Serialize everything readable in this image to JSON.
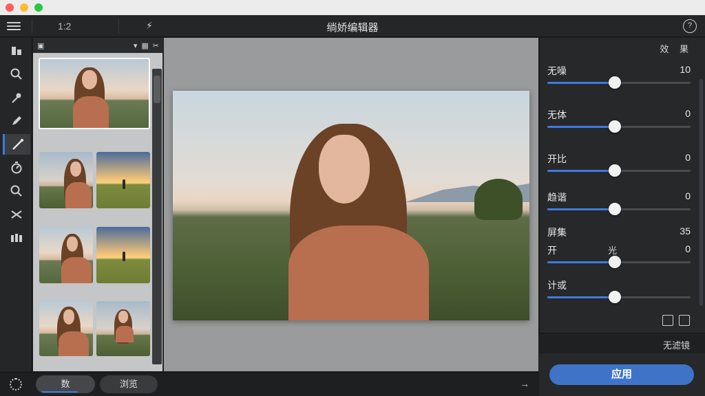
{
  "toolbar": {
    "ratio": "1:2",
    "title": "绱娇编辑器",
    "flash_icon": "lightning-icon",
    "right_icon": "help-circle-icon"
  },
  "rail": {
    "tools": [
      "layers-icon",
      "search-icon",
      "eyedropper-icon",
      "pencil-icon",
      "brush-icon",
      "timer-icon",
      "zoom-icon",
      "shuffle-icon",
      "panels-icon"
    ],
    "active_index": 4
  },
  "strip": {
    "head_icons": [
      "image-icon",
      "chevron-down-icon",
      "grid-icon",
      "crop-icon"
    ]
  },
  "panel": {
    "head": "效 果",
    "adjustments": [
      {
        "label": "无噪",
        "value": "10",
        "pos": 0.47
      },
      {
        "label": "无体",
        "value": "0",
        "pos": 0.47
      },
      {
        "label": "开比",
        "value": "0",
        "pos": 0.47
      },
      {
        "label": "趋谐",
        "value": "0",
        "pos": 0.47
      },
      {
        "label": "屏集",
        "value": "35",
        "pos": null
      },
      {
        "label": "开",
        "mid": "光",
        "value": "0",
        "pos": 0.47
      },
      {
        "label": "计或",
        "value": "",
        "pos": 0.47
      }
    ],
    "preset_label": "无滤镜",
    "apply_label": "应用"
  },
  "bottom": {
    "tab_one": "数",
    "tab_two": "浏览",
    "tab_one_progress": 0.75
  },
  "colors": {
    "accent": "#3f7be0",
    "apply": "#3e73c8"
  }
}
